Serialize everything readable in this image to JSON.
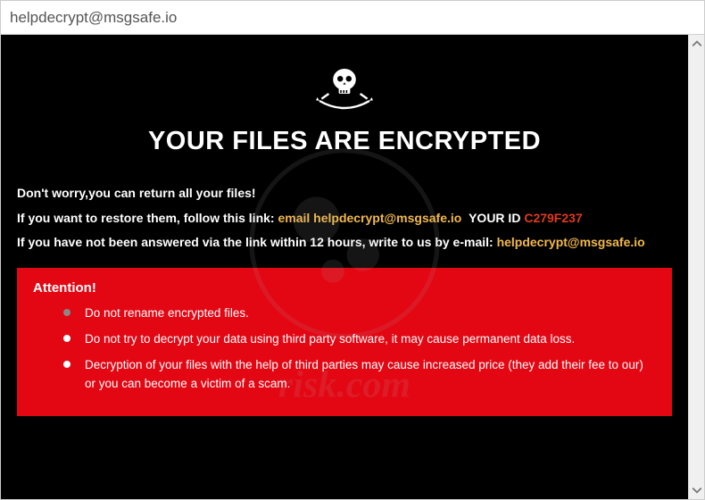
{
  "window": {
    "title": "helpdecrypt@msgsafe.io"
  },
  "header": {
    "title": "YOUR FILES ARE ENCRYPTED"
  },
  "lines": {
    "l1": "Don't worry,you can return all your files!",
    "l2_pre": "If you want to restore them, follow this link:",
    "l2_email_label": "email",
    "l2_email": "helpdecrypt@msgsafe.io",
    "l2_id_label": "YOUR ID",
    "l2_id": "C279F237",
    "l3_pre": "If you have not been answered via the link within 12 hours, write to us by e-mail:",
    "l3_email": "helpdecrypt@msgsafe.io"
  },
  "attention": {
    "title": "Attention!",
    "items": [
      "Do not rename encrypted files.",
      "Do not try to decrypt your data using third party software, it may cause permanent data loss.",
      "Decryption of your files with the help of third parties may cause increased price (they add their fee to our) or you can become a victim of a scam."
    ]
  },
  "watermark": {
    "text": "pcrisk",
    "url": "risk.com"
  }
}
